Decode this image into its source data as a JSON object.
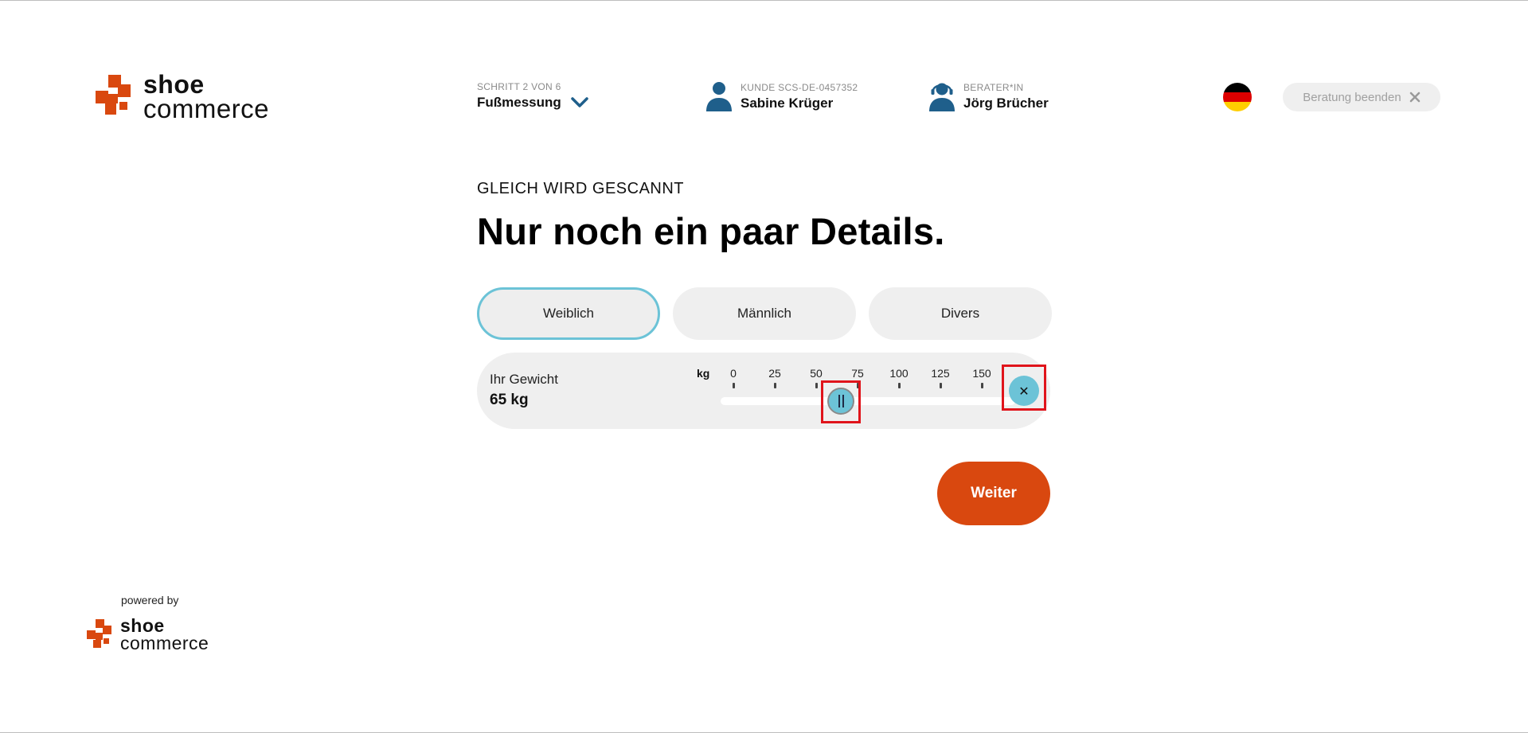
{
  "brand": {
    "line1": "shoe",
    "line2": "commerce",
    "color": "#d9480f"
  },
  "step": {
    "label": "SCHRITT 2 VON 6",
    "value": "Fußmessung"
  },
  "customer": {
    "label": "KUNDE SCS-DE-0457352",
    "name": "Sabine Krüger"
  },
  "advisor": {
    "label": "BERATER*IN",
    "name": "Jörg Brücher"
  },
  "language": {
    "flag_colors": [
      "#000000",
      "#dd0000",
      "#ffce00"
    ]
  },
  "end_session": {
    "label": "Beratung beenden",
    "icon": "close-icon"
  },
  "main": {
    "eyebrow": "GLEICH WIRD GESCANNT",
    "headline": "Nur noch ein paar Details."
  },
  "gender": {
    "options": [
      "Weiblich",
      "Männlich",
      "Divers"
    ],
    "selected": "Weiblich"
  },
  "weight": {
    "label": "Ihr Gewicht",
    "value_text": "65 kg",
    "unit": "kg",
    "ticks": [
      "0",
      "25",
      "50",
      "75",
      "100",
      "125",
      "150"
    ],
    "min": 0,
    "max": 150,
    "value": 65
  },
  "next_button": {
    "label": "Weiter"
  },
  "footer": {
    "powered_by": "powered by"
  },
  "colors": {
    "accent": "#6cc3d7",
    "primary": "#d9480f",
    "highlight": "#e0141b"
  }
}
